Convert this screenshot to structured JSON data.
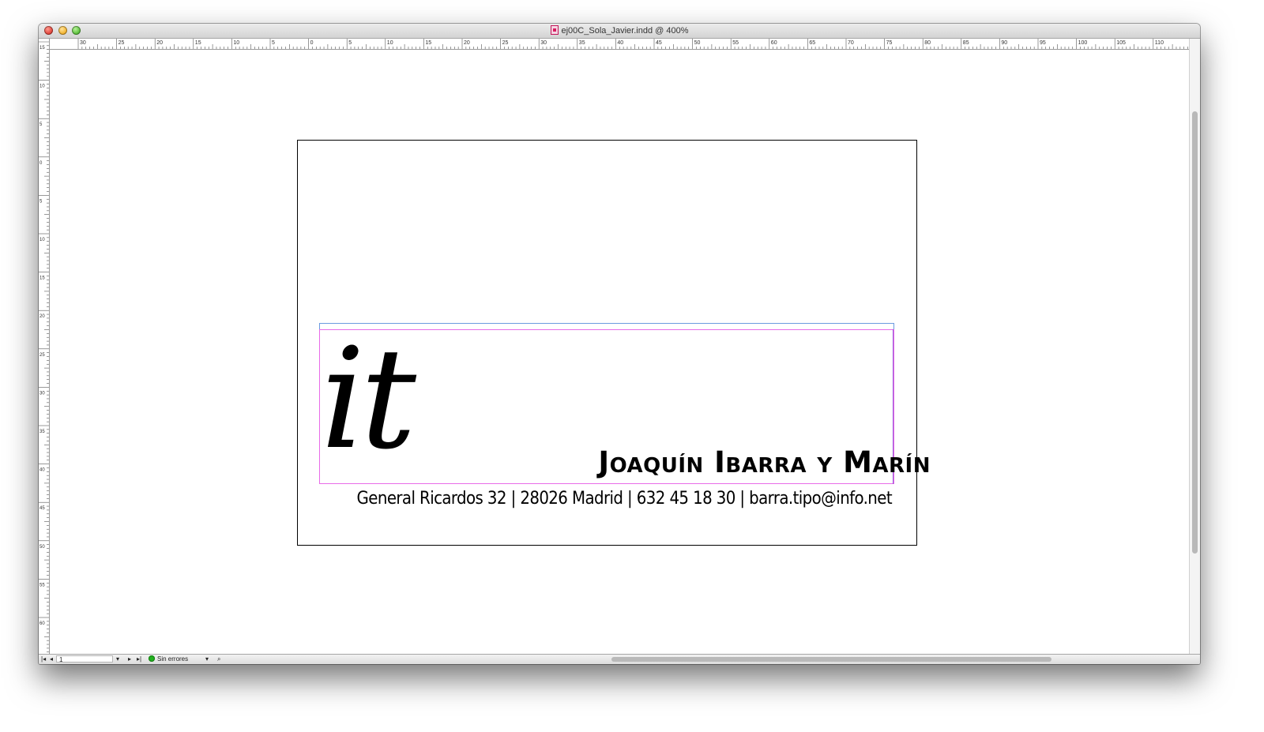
{
  "window": {
    "title": "ej00C_Sola_Javier.indd @ 400%"
  },
  "ruler": {
    "horizontal_labels": [
      "30",
      "25",
      "20",
      "15",
      "10",
      "5",
      "0",
      "5",
      "10",
      "15",
      "20",
      "25",
      "30",
      "35",
      "40",
      "45",
      "50",
      "55",
      "60",
      "65",
      "70",
      "75",
      "80",
      "85",
      "90",
      "95",
      "100",
      "105",
      "110"
    ],
    "vertical_labels": [
      "15",
      "10",
      "5",
      "0",
      "5",
      "10",
      "15",
      "20",
      "25",
      "30",
      "35",
      "40",
      "45",
      "50",
      "55",
      "60"
    ]
  },
  "document": {
    "logo": "it",
    "name": "Joaquín Ibarra y Marín",
    "address": "General Ricardos 32 | 28026 Madrid | 632 45 18 30 | barra.tipo@info.net"
  },
  "statusbar": {
    "page": "1",
    "preflight": "Sin errores"
  }
}
